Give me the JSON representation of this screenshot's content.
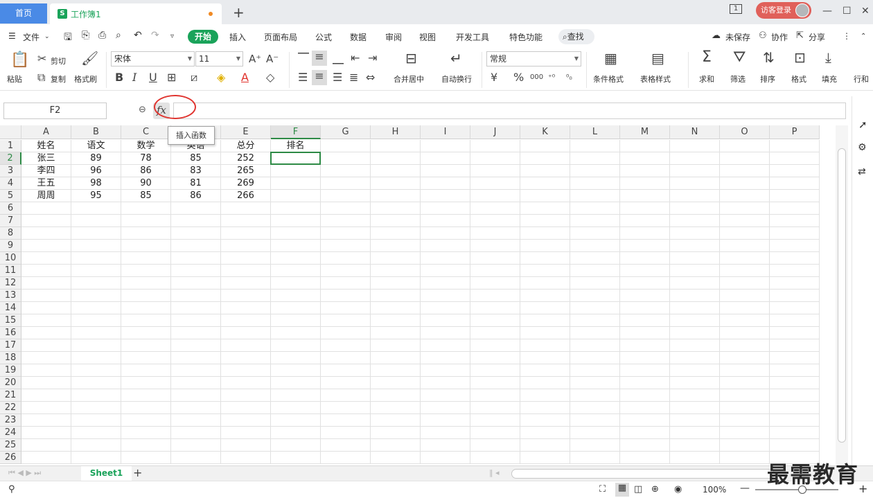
{
  "tabs": {
    "home": "首页",
    "doc": "工作簿1",
    "doc_icon": "S",
    "new": "+"
  },
  "window": {
    "login": "访客登录",
    "page_indicator": "1"
  },
  "menu": {
    "file": "文件",
    "items": [
      "开始",
      "插入",
      "页面布局",
      "公式",
      "数据",
      "审阅",
      "视图",
      "开发工具",
      "特色功能"
    ],
    "search": "查找",
    "unsaved": "未保存",
    "collab": "协作",
    "share": "分享"
  },
  "toolbar": {
    "paste": "粘贴",
    "cut": "剪切",
    "copy": "复制",
    "format_painter": "格式刷",
    "font_name": "宋体",
    "font_size": "11",
    "bold": "B",
    "italic": "I",
    "underline": "U",
    "merge_center": "合并居中",
    "wrap": "自动换行",
    "number_format": "常规",
    "currency": "¥",
    "percent": "%",
    "thousands": "000",
    "cond_format": "条件格式",
    "table_style": "表格样式",
    "sum": "求和",
    "filter": "筛选",
    "sort": "排序",
    "format": "格式",
    "fill": "填充",
    "rowcol": "行和"
  },
  "formula": {
    "name_box": "F2",
    "fx": "fx",
    "tooltip": "插入函数",
    "content": ""
  },
  "columns": [
    "A",
    "B",
    "C",
    "D",
    "E",
    "F",
    "G",
    "H",
    "I",
    "J",
    "K",
    "L",
    "M",
    "N",
    "O",
    "P"
  ],
  "rows": [
    "1",
    "2",
    "3",
    "4",
    "5",
    "6",
    "7",
    "8",
    "9",
    "10",
    "11",
    "12",
    "13",
    "14",
    "15",
    "16",
    "17",
    "18",
    "19",
    "20",
    "21",
    "22",
    "23",
    "24",
    "25",
    "26"
  ],
  "table": [
    [
      "姓名",
      "语文",
      "数学",
      "英语",
      "总分",
      "排名"
    ],
    [
      "张三",
      "89",
      "78",
      "85",
      "252",
      ""
    ],
    [
      "李四",
      "96",
      "86",
      "83",
      "265",
      ""
    ],
    [
      "王五",
      "98",
      "90",
      "81",
      "269",
      ""
    ],
    [
      "周周",
      "95",
      "85",
      "86",
      "266",
      ""
    ]
  ],
  "selected_cell": "F2",
  "sheets": [
    "Sheet1"
  ],
  "status": {
    "zoom": "100%"
  },
  "watermark": "最需教育"
}
